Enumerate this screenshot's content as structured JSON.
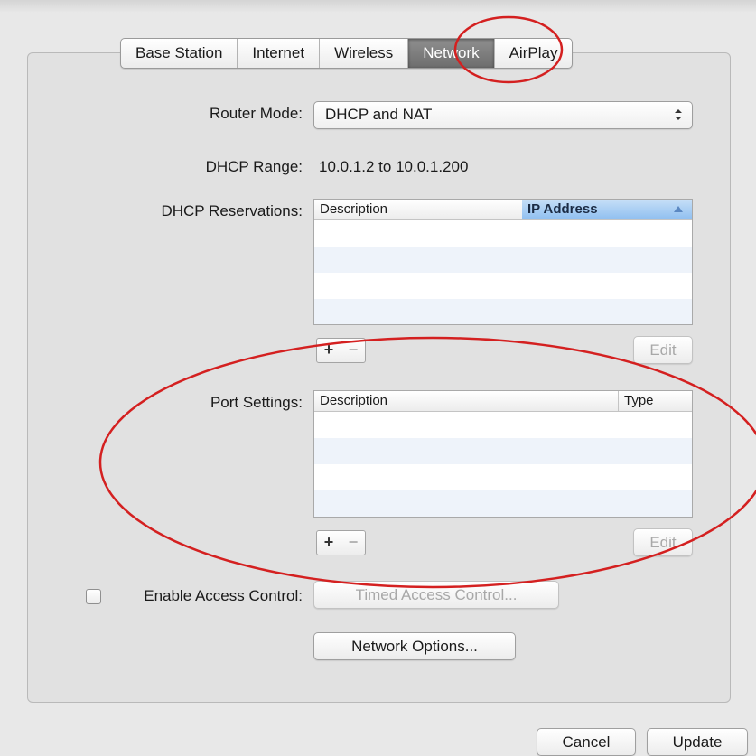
{
  "tabs": [
    {
      "label": "Base Station",
      "selected": false
    },
    {
      "label": "Internet",
      "selected": false
    },
    {
      "label": "Wireless",
      "selected": false
    },
    {
      "label": "Network",
      "selected": true
    },
    {
      "label": "AirPlay",
      "selected": false
    }
  ],
  "router_mode": {
    "label": "Router Mode:",
    "value": "DHCP and NAT"
  },
  "dhcp_range": {
    "label": "DHCP Range:",
    "value": "10.0.1.2 to 10.0.1.200"
  },
  "dhcp_reservations": {
    "label": "DHCP Reservations:",
    "columns": [
      "Description",
      "IP Address"
    ],
    "sorted_column": "IP Address",
    "rows": [],
    "edit_label": "Edit"
  },
  "port_settings": {
    "label": "Port Settings:",
    "columns": [
      "Description",
      "Type"
    ],
    "rows": [],
    "edit_label": "Edit"
  },
  "add_symbol": "+",
  "remove_symbol": "−",
  "access_control": {
    "label": "Enable Access Control:",
    "checked": false,
    "button_label": "Timed Access Control..."
  },
  "network_options_label": "Network Options...",
  "footer": {
    "cancel_label": "Cancel",
    "update_label": "Update"
  },
  "annotation_color": "#d42020"
}
